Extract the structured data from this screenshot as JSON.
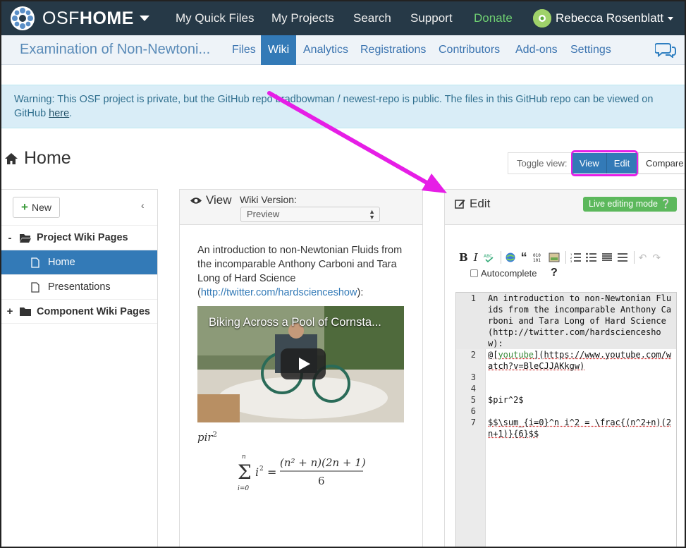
{
  "topbar": {
    "brand_prefix": "OSF",
    "brand_suffix": "HOME",
    "nav": [
      "My Quick Files",
      "My Projects",
      "Search",
      "Support",
      "Donate"
    ],
    "user_name": "Rebecca Rosenblatt"
  },
  "project_nav": {
    "title": "Examination of Non-Newtoni...",
    "tabs": [
      "Files",
      "Wiki",
      "Analytics",
      "Registrations",
      "Contributors",
      "Add-ons",
      "Settings"
    ],
    "active_tab": "Wiki"
  },
  "warning": {
    "text": "Warning: This OSF project is private, but the GitHub repo bradbowman / newest-repo is public. The files in this GitHub repo can be viewed on GitHub ",
    "link_text": "here",
    "end": "."
  },
  "page": {
    "title": "Home",
    "toggle_label": "Toggle view:",
    "toggle_view": "View",
    "toggle_edit": "Edit",
    "toggle_compare": "Compare"
  },
  "sidebar": {
    "new_label": "New",
    "items": [
      {
        "sign": "-",
        "label": "Project Wiki Pages"
      },
      {
        "label": "Home"
      },
      {
        "label": "Presentations"
      },
      {
        "sign": "+",
        "label": "Component Wiki Pages"
      }
    ]
  },
  "view_panel": {
    "title": "View",
    "version_label": "Wiki Version:",
    "version_value": "Preview",
    "intro_text": "An introduction to non-Newtonian Fluids from the incomparable Anthony Carboni and Tara Long of Hard Science (",
    "intro_link": "http://twitter.com/hardscienceshow",
    "intro_end": "):",
    "video_title": "Biking Across a Pool of Cornsta...",
    "formula_pir": "pir",
    "formula_pir_exp": "2"
  },
  "edit_panel": {
    "title": "Edit",
    "live_mode": "Live editing mode",
    "autocomplete": "Autocomplete",
    "help": "?",
    "lines": [
      {
        "n": "1",
        "text": "An introduction to non-Newtonian Fluids from the incomparable Anthony Carboni and Tara Long of Hard Science (http://twitter.com/hardscienceshow):"
      },
      {
        "n": "2",
        "pre": "@[",
        "kw": "youtube",
        "post": "](https://www.youtube.com/watch?v=BleCJJAKkgw)"
      },
      {
        "n": "3",
        "text": ""
      },
      {
        "n": "4",
        "text": ""
      },
      {
        "n": "5",
        "text": "$pir^2$"
      },
      {
        "n": "6",
        "text": ""
      },
      {
        "n": "7",
        "text": "$$\\sum_{i=0}^n i^2 = \\frac{(n^2+n)(2n+1)}{6}$$"
      }
    ]
  },
  "colors": {
    "navbar": "#263947",
    "accent": "#337ab7",
    "donate": "#6fcf72",
    "highlight": "#e61ee6",
    "live": "#5cb85c"
  }
}
